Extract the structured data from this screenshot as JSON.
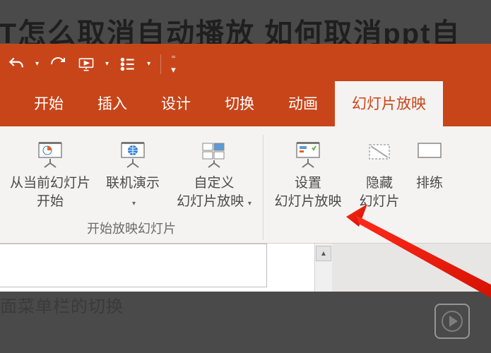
{
  "background": {
    "title": "PT怎么取消自动播放  如何取消ppt自",
    "caption": "面菜单栏的切换"
  },
  "qat": {
    "undo_name": "undo-icon",
    "redo_name": "redo-icon",
    "from_start_name": "start-from-beginning-icon",
    "list_name": "list-icon"
  },
  "tabs": [
    {
      "label": "开始",
      "active": false
    },
    {
      "label": "插入",
      "active": false
    },
    {
      "label": "设计",
      "active": false
    },
    {
      "label": "切换",
      "active": false
    },
    {
      "label": "动画",
      "active": false
    },
    {
      "label": "幻灯片放映",
      "active": true
    }
  ],
  "ribbon": {
    "group1": {
      "label": "开始放映幻灯片",
      "buttons": [
        {
          "label": "从当前幻灯片\n开始",
          "dropdown": false
        },
        {
          "label": "联机演示",
          "dropdown": true
        },
        {
          "label": "自定义\n幻灯片放映",
          "dropdown": true
        }
      ]
    },
    "group2": {
      "buttons": [
        {
          "label": "设置\n幻灯片放映",
          "dropdown": false
        },
        {
          "label": "隐藏\n幻灯片",
          "dropdown": false
        },
        {
          "label": "排练",
          "dropdown": false
        }
      ]
    }
  }
}
